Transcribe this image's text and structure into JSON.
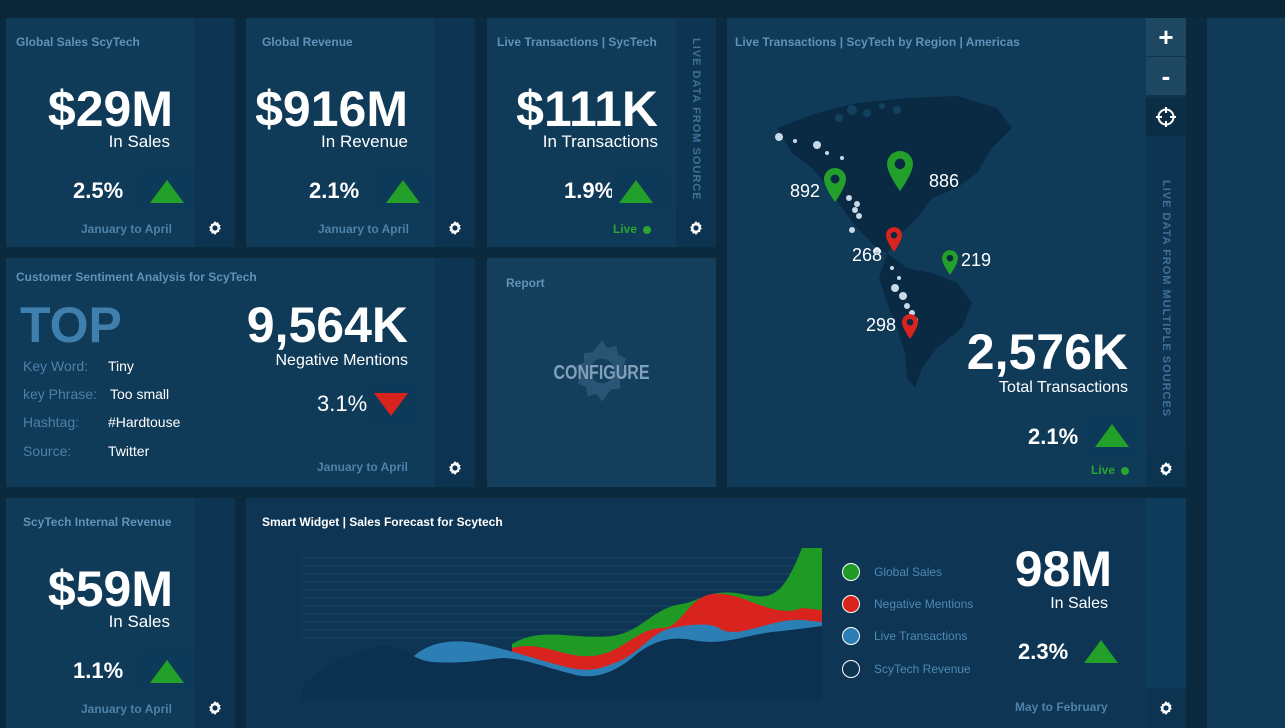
{
  "global_sales": {
    "title": "Global Sales ScyTech",
    "value": "$29M",
    "caption": "In Sales",
    "pct": "2.5%",
    "range": "January to April"
  },
  "global_revenue": {
    "title": "Global Revenue",
    "value": "$916M",
    "caption": "In Revenue",
    "pct": "2.1%",
    "range": "January to April"
  },
  "live_transactions": {
    "title": "Live Transactions | SycTech",
    "value": "$111K",
    "caption": "In Transactions",
    "pct": "1.9%",
    "live": "Live",
    "side": "LIVE DATA FROM SOURCE"
  },
  "region_map": {
    "title": "Live Transactions  |  ScyTech by Region  |  Americas",
    "zoom_in": "+",
    "zoom_out": "-",
    "pins": [
      {
        "label": "892",
        "color": "#23a02a"
      },
      {
        "label": "886",
        "color": "#23a02a"
      },
      {
        "label": "268",
        "color": "#d9231f"
      },
      {
        "label": "219",
        "color": "#23a02a"
      },
      {
        "label": "298",
        "color": "#d9231f"
      }
    ],
    "value": "2,576K",
    "caption": "Total Transactions",
    "pct": "2.1%",
    "live": "Live",
    "side": "LIVE DATA FROM MULTIPLE SOURCES"
  },
  "sentiment": {
    "title": "Customer Sentiment Analysis for ScyTech",
    "top": "TOP",
    "rows": [
      {
        "key": "Key Word:",
        "value": "Tiny"
      },
      {
        "key": "key Phrase:",
        "value": "Too small"
      },
      {
        "key": "Hashtag:",
        "value": "#Hardtouse"
      },
      {
        "key": "Source:",
        "value": "Twitter"
      }
    ],
    "value": "9,564K",
    "caption": "Negative Mentions",
    "pct": "3.1%",
    "range": "January to April"
  },
  "report": {
    "title": "Report",
    "configure": "CONFIGURE"
  },
  "internal_revenue": {
    "title": "ScyTech Internal Revenue",
    "value": "$59M",
    "caption": "In Sales",
    "pct": "1.1%",
    "range": "January to April"
  },
  "forecast": {
    "title": "Smart Widget  |  Sales Forecast for Scytech",
    "legend": [
      {
        "label": "Global Sales",
        "color": "#1f9a25"
      },
      {
        "label": "Negative Mentions",
        "color": "#d9231f"
      },
      {
        "label": "Live Transactions",
        "color": "#2b7fb5"
      },
      {
        "label": "ScyTech Revenue",
        "color": "#0d3450"
      }
    ],
    "value": "98M",
    "caption": "In Sales",
    "pct": "2.3%",
    "range": "May to February"
  },
  "colors": {
    "up": "#23a02a",
    "down": "#d9231f",
    "panel": "#0f3a58",
    "bg": "#0b2a3e"
  }
}
